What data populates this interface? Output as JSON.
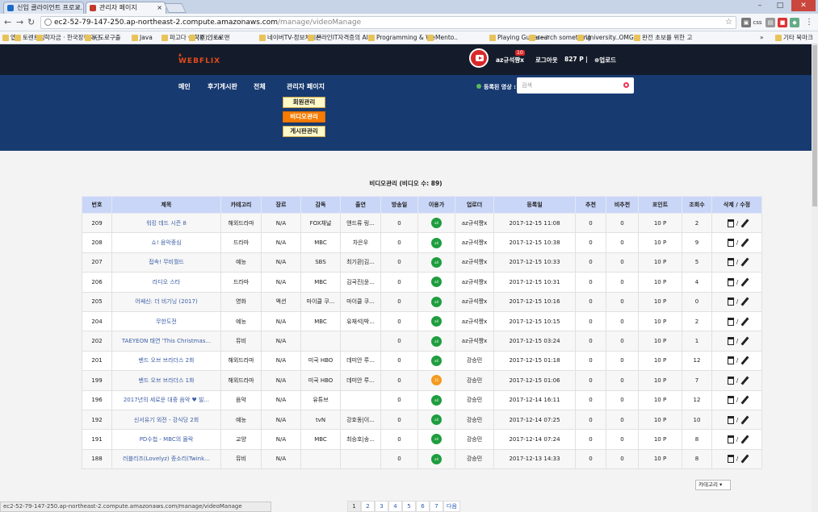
{
  "browser": {
    "tabs": [
      {
        "label": "신입 클라이언트 프로그..."
      },
      {
        "label": "관리자 페이지"
      }
    ],
    "url_host": "ec2-52-79-147-250.ap-northeast-2.compute.amazonaws.com",
    "url_path": "/manage/videoManage",
    "bookmarks": [
      "앱",
      "토렌트킹",
      "학자금 · 한국장학재단",
      "» 도로구출",
      "Java",
      "파고다 어학원 : I ca",
      "(주)인트로맨",
      "네이버TV-정보처리산",
      "온라인IT자격증의 AI",
      "Programming & We",
      "Mento..",
      "Playing Guitar~♪",
      "search something",
      "University..OMG",
      "완전 초보를 위한 고",
      "기타 북마크"
    ],
    "bookmark_more": "»",
    "ext_css": "css"
  },
  "header": {
    "logo": "WEBFLIX",
    "username": "az규석쨩x",
    "badge": "10",
    "logout": "로그아웃",
    "points": "827 P",
    "upload": "업로드",
    "menu": [
      "메인",
      "후기게시판",
      "전체",
      "관리자 페이지"
    ],
    "submenu": [
      "회원관리",
      "비디오관리",
      "게시판관리"
    ],
    "reg_label": "등록된 영상 :",
    "search_placeholder": "검색"
  },
  "main": {
    "caption": "비디오관리 (비디오 수: 89)",
    "columns": [
      "번호",
      "제목",
      "카테고리",
      "장르",
      "감독",
      "출연",
      "방송일",
      "이용가",
      "업로더",
      "등록일",
      "추천",
      "비추천",
      "포인트",
      "조회수",
      "삭제 / 수정"
    ],
    "rows": [
      [
        "209",
        "워킹 데드 시즌 8",
        "해외드라마",
        "N/A",
        "FOX채널",
        "앤드류 링...",
        "0",
        "all",
        "az규석쨩x",
        "2017-12-15 11:08",
        "0",
        "0",
        "10 P",
        "2"
      ],
      [
        "208",
        "쇼! 음악중심",
        "드라마",
        "N/A",
        "MBC",
        "차은우",
        "0",
        "all",
        "az규석쨩x",
        "2017-12-15 10:38",
        "0",
        "0",
        "10 P",
        "9"
      ],
      [
        "207",
        "접속! 무비월드",
        "예능",
        "N/A",
        "SBS",
        "최기환|김...",
        "0",
        "all",
        "az규석쨩x",
        "2017-12-15 10:33",
        "0",
        "0",
        "10 P",
        "5"
      ],
      [
        "206",
        "라디오 스타",
        "드라마",
        "N/A",
        "MBC",
        "김국진|윤...",
        "0",
        "all",
        "az규석쨩x",
        "2017-12-15 10:31",
        "0",
        "0",
        "10 P",
        "4"
      ],
      [
        "205",
        "어쌔신: 더 비기닝 (2017)",
        "영화",
        "액션",
        "마이클 쿠...",
        "마이클 쿠...",
        "0",
        "all",
        "az규석쨩x",
        "2017-12-15 10:16",
        "0",
        "0",
        "10 P",
        "0"
      ],
      [
        "204",
        "무한도전",
        "예능",
        "N/A",
        "MBC",
        "유재석|박...",
        "0",
        "all",
        "az규석쨩x",
        "2017-12-15 10:15",
        "0",
        "0",
        "10 P",
        "2"
      ],
      [
        "202",
        "TAEYEON 태연 'This Christmas...",
        "뮤비",
        "N/A",
        "",
        "",
        "0",
        "all",
        "az규석쨩x",
        "2017-12-15 03:24",
        "0",
        "0",
        "10 P",
        "1"
      ],
      [
        "201",
        "밴드 오브 브라더스 2화",
        "해외드라마",
        "N/A",
        "미국 HBO",
        "데미안 루...",
        "0",
        "all",
        "강승민",
        "2017-12-15 01:18",
        "0",
        "0",
        "10 P",
        "12"
      ],
      [
        "199",
        "밴드 오브 브라더스 1화",
        "해외드라마",
        "N/A",
        "미국 HBO",
        "데미안 루...",
        "0",
        "15",
        "강승민",
        "2017-12-15 01:06",
        "0",
        "0",
        "10 P",
        "7"
      ],
      [
        "196",
        "2017년의 세로운 대중 음악 ♥ 빌...",
        "음악",
        "N/A",
        "유튜브",
        "",
        "0",
        "all",
        "강승민",
        "2017-12-14 16:11",
        "0",
        "0",
        "10 P",
        "12"
      ],
      [
        "192",
        "신서유기 외전 - 강식당 2회",
        "예능",
        "N/A",
        "tvN",
        "강호동|이...",
        "0",
        "all",
        "강승민",
        "2017-12-14 07:25",
        "0",
        "0",
        "10 P",
        "10"
      ],
      [
        "191",
        "PD수첩 - MBC의 몰락",
        "교양",
        "N/A",
        "MBC",
        "최승호|송...",
        "0",
        "all",
        "강승민",
        "2017-12-14 07:24",
        "0",
        "0",
        "10 P",
        "8"
      ],
      [
        "188",
        "러블리즈(Lovelyz) 종소리(Twink...",
        "뮤비",
        "N/A",
        "",
        "",
        "0",
        "all",
        "강승민",
        "2017-12-13 14:33",
        "0",
        "0",
        "10 P",
        "8"
      ]
    ],
    "category_select": "카테고리 ▾",
    "pages": [
      "1",
      "2",
      "3",
      "4",
      "5",
      "6",
      "7",
      "다음"
    ]
  },
  "status_bar": "ec2-52-79-147-250.ap-northeast-2.compute.amazonaws.com/manage/videoManage",
  "colors": {
    "header_dark": "#141c2b",
    "nav_blue": "#173a70",
    "active_sub": "#f57c00",
    "table_head": "#c9d6f7",
    "age_all": "#1e9d3f",
    "age_15": "#f39a1e"
  }
}
